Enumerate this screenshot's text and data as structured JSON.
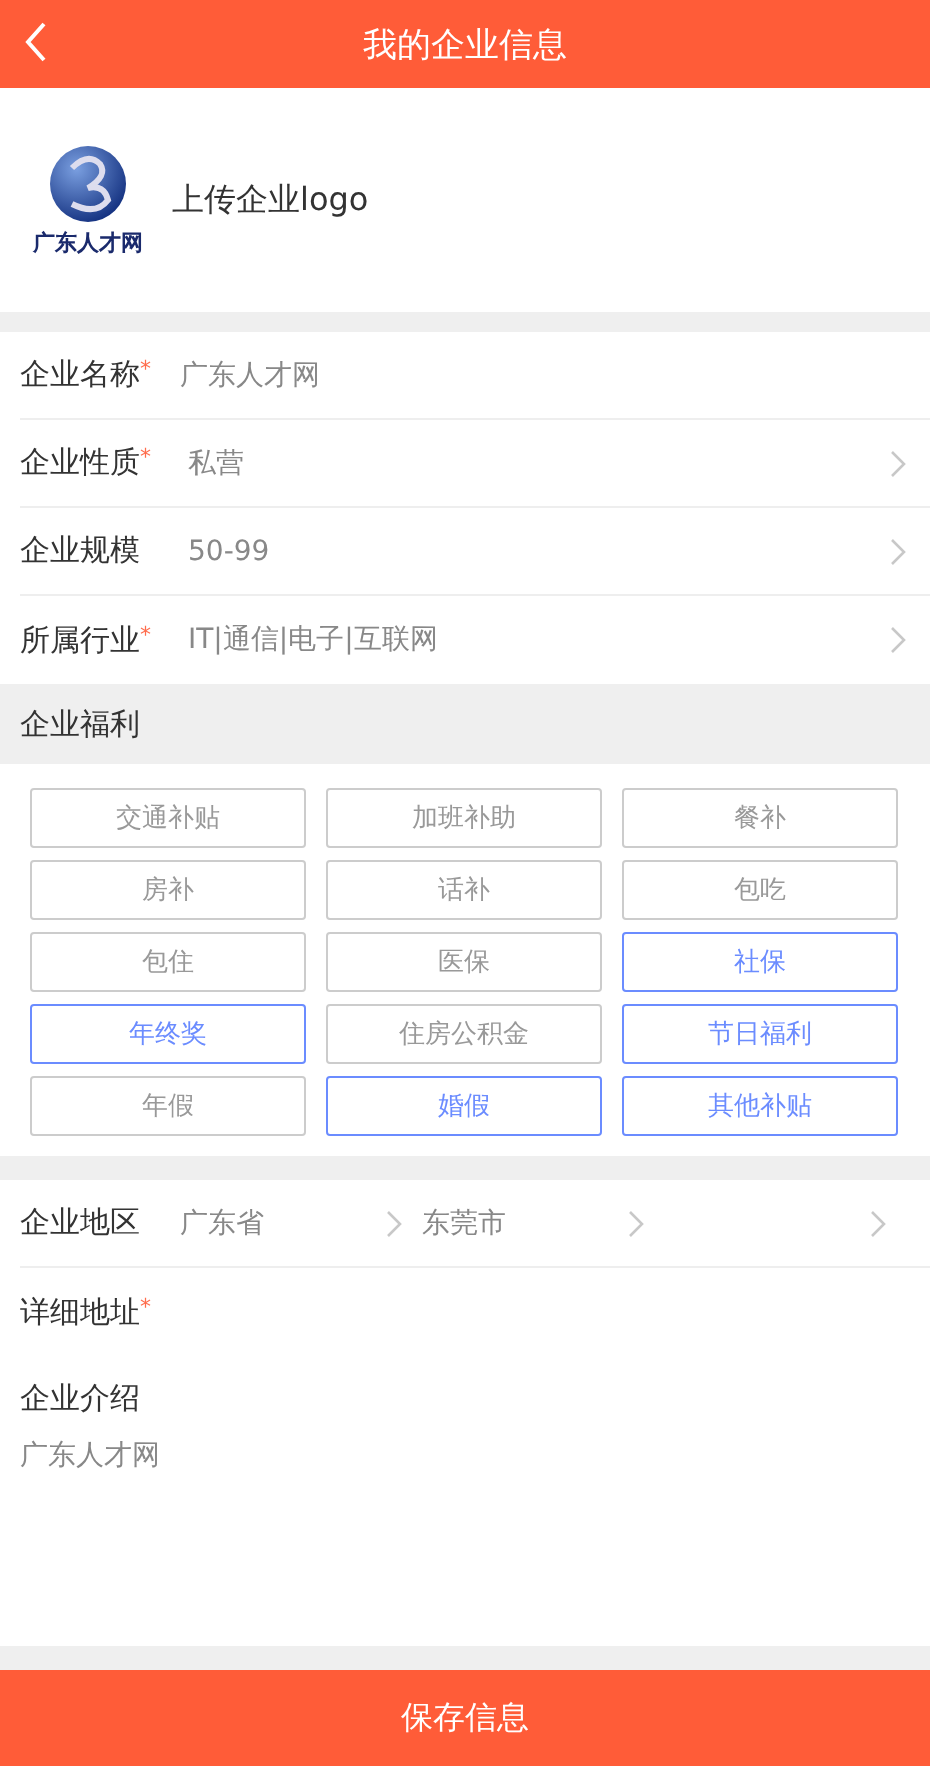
{
  "header": {
    "title": "我的企业信息"
  },
  "logo": {
    "text": "广东人才网",
    "upload_label": "上传企业logo"
  },
  "fields": [
    {
      "label": "企业名称",
      "required_mark": "*",
      "kind": "text",
      "value": "广东人才网"
    },
    {
      "label": "企业性质",
      "required_mark": "*",
      "kind": "select",
      "value": "私营"
    },
    {
      "label": "企业规模",
      "kind": "select",
      "value": "50-99"
    },
    {
      "label": "所属行业",
      "required_mark": "*",
      "kind": "select",
      "value": "IT|通信|电子|互联网"
    }
  ],
  "welfare": {
    "title": "企业福利",
    "tags": [
      {
        "label": "交通补贴",
        "selected": false
      },
      {
        "label": "加班补助",
        "selected": false
      },
      {
        "label": "餐补",
        "selected": false
      },
      {
        "label": "房补",
        "selected": false
      },
      {
        "label": "话补",
        "selected": false
      },
      {
        "label": "包吃",
        "selected": false
      },
      {
        "label": "包住",
        "selected": false
      },
      {
        "label": "医保",
        "selected": false
      },
      {
        "label": "社保",
        "selected": true
      },
      {
        "label": "年终奖",
        "selected": true
      },
      {
        "label": "住房公积金",
        "selected": false
      },
      {
        "label": "节日福利",
        "selected": true
      },
      {
        "label": "年假",
        "selected": false
      },
      {
        "label": "婚假",
        "selected": true
      },
      {
        "label": "其他补贴",
        "selected": true
      }
    ]
  },
  "region": {
    "label": "企业地区",
    "values": [
      "广东省",
      "东莞市"
    ]
  },
  "address": {
    "label": "详细地址",
    "required_mark": "*"
  },
  "intro": {
    "label": "企业介绍",
    "value": "广东人才网"
  },
  "save_button": "保存信息"
}
